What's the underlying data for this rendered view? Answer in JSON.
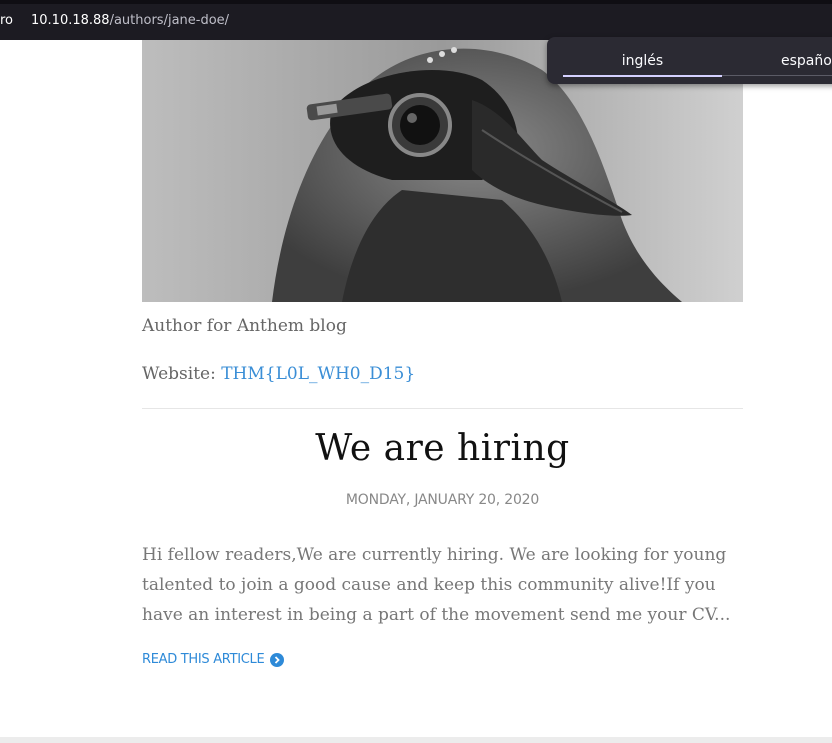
{
  "browser": {
    "left_fragment": "ro",
    "url_host": "10.10.18.88",
    "url_path": "/authors/jane-doe/"
  },
  "translate": {
    "source_language": "inglés",
    "target_language": "españo"
  },
  "author": {
    "photo_icon": "plague-doctor-mask-photo",
    "bio": "Author for Anthem blog",
    "website_label": "Website:",
    "website_value": "THM{L0L_WH0_D15}"
  },
  "post": {
    "title": "We are hiring",
    "date": "MONDAY, JANUARY 20, 2020",
    "excerpt": "Hi fellow readers,We are currently hiring. We are looking for young talented to join a good cause and keep this community alive!If you have an interest in being a part of the movement send me your CV...",
    "read_more": "READ THIS ARTICLE",
    "read_more_icon": "chevron-circle-right-icon"
  },
  "colors": {
    "link": "#3a8ed6",
    "urlbar_bg": "#1c1b22",
    "popup_bg": "#2b2a33"
  }
}
